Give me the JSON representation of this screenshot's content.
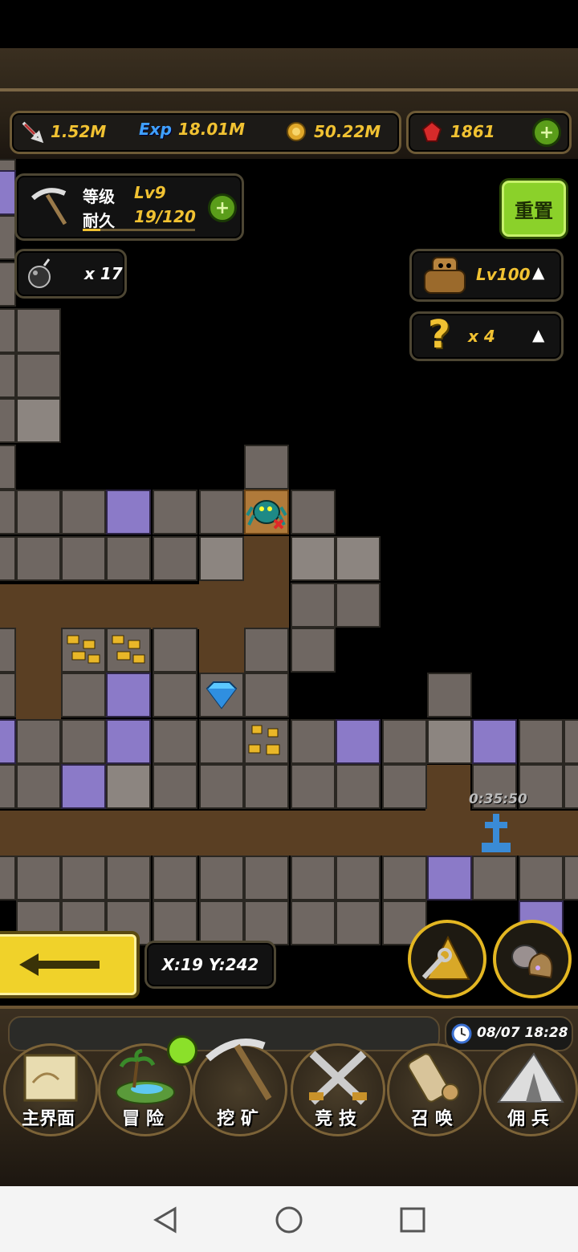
{
  "resources": {
    "attack": "1.52M",
    "exp_label": "Exp",
    "exp": "18.01M",
    "gold": "50.22M",
    "gems": "1861"
  },
  "pickaxe": {
    "level_label": "等级",
    "level_value": "Lv9",
    "durability_label": "耐久",
    "durability_value": "19/120",
    "durability_fraction": 0.16
  },
  "bomb": {
    "count": "x 17"
  },
  "reset_button": "重置",
  "golem": {
    "level": "Lv100"
  },
  "mystery": {
    "count": "x 4"
  },
  "timer": "0:35:50",
  "coords": "X:19 Y:242",
  "clock": "08/07 18:28",
  "nav": [
    {
      "label": "主界面",
      "icon": "map-scroll-icon"
    },
    {
      "label": "冒 险",
      "icon": "island-icon"
    },
    {
      "label": "挖 矿",
      "icon": "pickaxe-icon"
    },
    {
      "label": "竞 技",
      "icon": "crossed-swords-icon"
    },
    {
      "label": "召 唤",
      "icon": "summon-scroll-icon"
    },
    {
      "label": "佣 兵",
      "icon": "tent-icon"
    }
  ],
  "colors": {
    "gold_text": "#f1c232",
    "green_button": "#8bd12a",
    "stone": "#6f6762",
    "amethyst": "#8b7ac8",
    "dirt": "#5a3f23"
  }
}
